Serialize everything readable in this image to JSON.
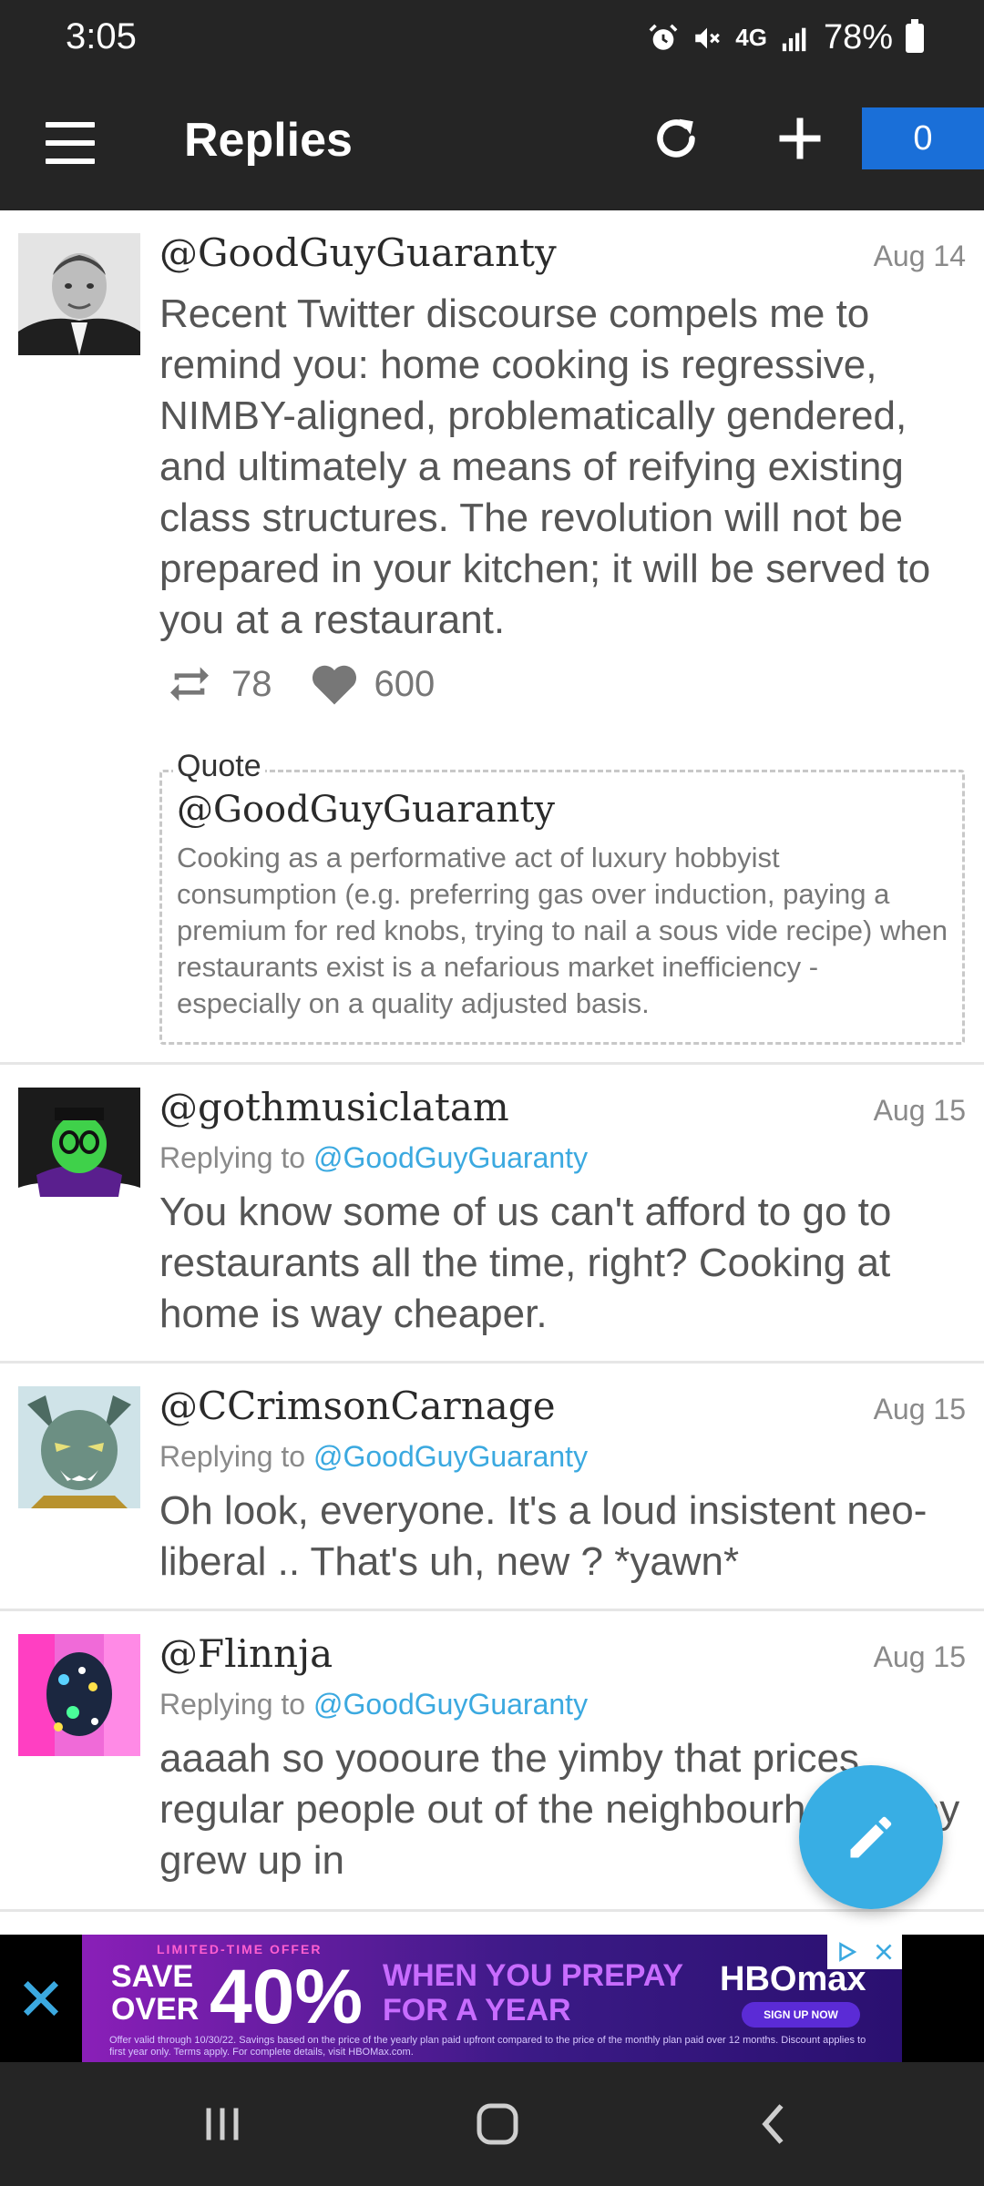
{
  "status_bar": {
    "time": "3:05",
    "network": "4G",
    "battery": "78%",
    "icons": [
      "alarm-icon",
      "mute-icon",
      "signal-icon",
      "battery-icon"
    ]
  },
  "app_bar": {
    "title": "Replies",
    "counter": "0",
    "icons": [
      "menu-icon",
      "refresh-icon",
      "plus-icon"
    ]
  },
  "posts": [
    {
      "handle": "@GoodGuyGuaranty",
      "date": "Aug 14",
      "text": "Recent Twitter discourse compels me to remind you: home cooking is regressive, NIMBY-aligned, problematically gendered, and ultimately a means of reifying existing class structures. The revolution will not be prepared in your kitchen; it will be served to you at a restaurant.",
      "retweets": "78",
      "likes": "600",
      "quote": {
        "label": "Quote",
        "handle": "@GoodGuyGuaranty",
        "text": "Cooking as a performative act of luxury hobbyist consumption (e.g. preferring gas over induction, paying a premium for red knobs, trying to nail a sous vide recipe) when restaurants exist is a nefarious market inefficiency - especially on a quality adjusted basis."
      }
    },
    {
      "handle": "@gothmusiclatam",
      "date": "Aug 15",
      "replying_prefix": "Replying to",
      "replying_to": "@GoodGuyGuaranty",
      "text": "You know some of us can't afford to go to restaurants all the time, right? Cooking at home is way cheaper."
    },
    {
      "handle": "@CCrimsonCarnage",
      "date": "Aug 15",
      "replying_prefix": "Replying to",
      "replying_to": "@GoodGuyGuaranty",
      "text": "Oh look, everyone. It's a loud insistent neo-liberal .. That's uh, new ? *yawn*"
    },
    {
      "handle": "@Flinnja",
      "date": "Aug 15",
      "replying_prefix": "Replying to",
      "replying_to": "@GoodGuyGuaranty",
      "text": "aaaah so yoooure the yimby that prices regular people out of the neighbourhood they grew up in"
    }
  ],
  "ad": {
    "tag": "LIMITED-TIME OFFER",
    "save": "SAVE OVER",
    "percent": "40%",
    "prepay": "WHEN YOU PREPAY FOR A YEAR",
    "brand": "HBOmax",
    "cta": "SIGN UP NOW",
    "fine_print": "Offer valid through 10/30/22. Savings based on the price of the yearly plan paid upfront compared to the price of the monthly plan paid over 12 months. Discount applies to first year only. Terms apply. For complete details, visit HBOMax.com."
  },
  "colors": {
    "bar_bg": "#252525",
    "counter_bg": "#1a6fd8",
    "mention": "#3ba9e0",
    "fab": "#38aee4"
  }
}
